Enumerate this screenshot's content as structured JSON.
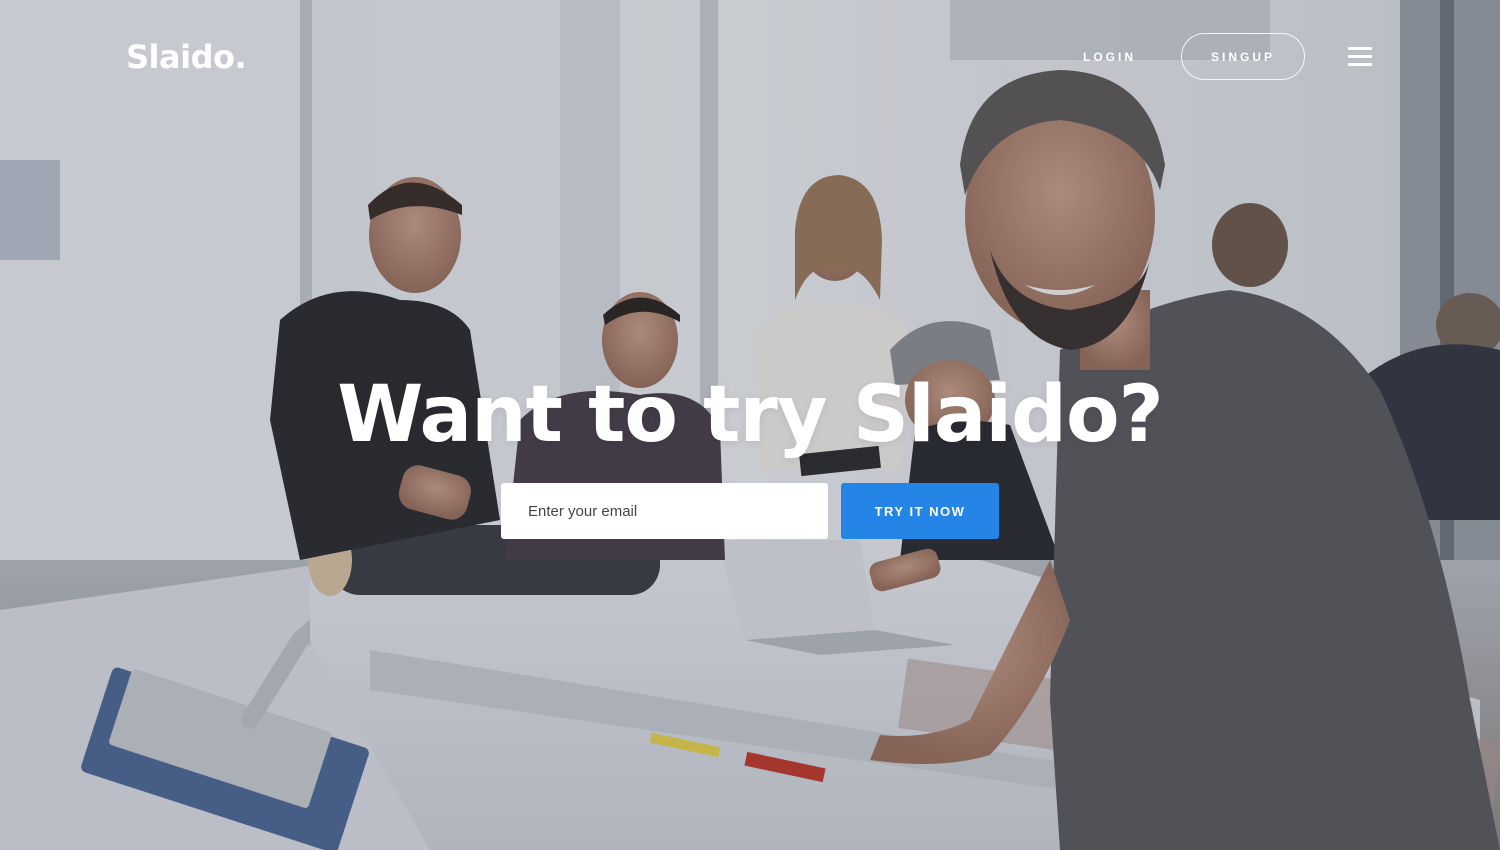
{
  "nav": {
    "logo": "Slaido.",
    "login_label": "LOGIN",
    "signup_label": "SINGUP",
    "menu_icon": "hamburger-menu-icon"
  },
  "hero": {
    "headline": "Want to try Slaido?",
    "email_placeholder": "Enter your email",
    "email_value": "",
    "cta_label": "TRY IT NOW"
  },
  "colors": {
    "accent": "#2585e6",
    "text_on_photo": "#ffffff"
  }
}
